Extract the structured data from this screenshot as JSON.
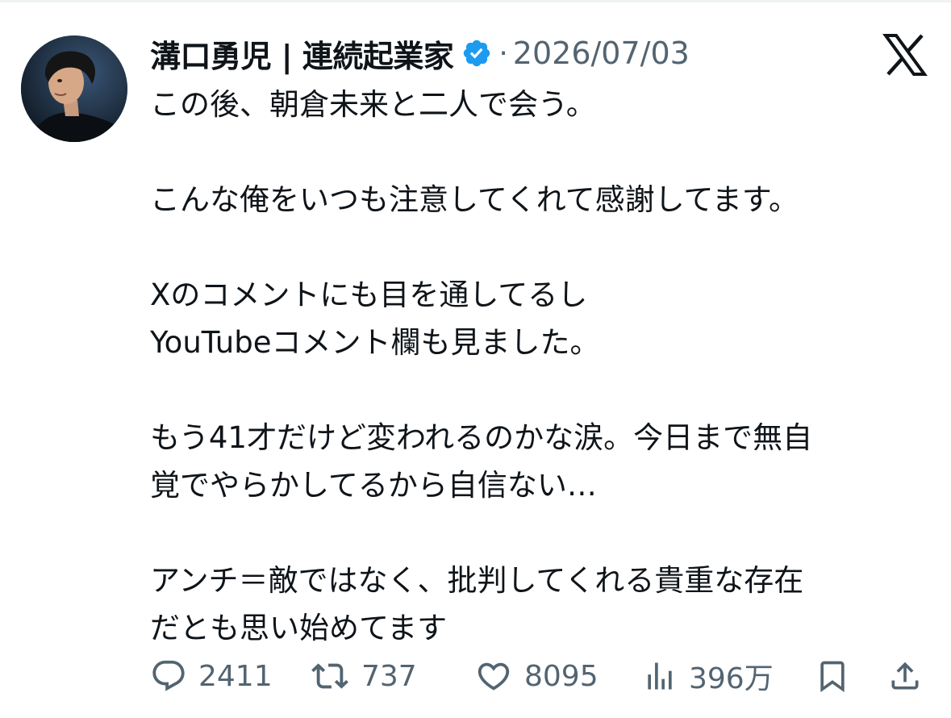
{
  "tweet": {
    "author_name": "溝口勇児 | 連続起業家",
    "separator": "·",
    "date": "2026/07/03",
    "verified_icon": "verified-badge-icon",
    "brand_icon": "x-logo-icon",
    "paragraphs": [
      [
        "この後、朝倉未来と二人で会う。"
      ],
      [
        "こんな俺をいつも注意してくれて感謝してます。"
      ],
      [
        "Xのコメントにも目を通してるし",
        "YouTubeコメント欄も見ました。"
      ],
      [
        "もう41才だけど変われるのかな涙。今日まで無自",
        "覚でやらかしてるから自信ない…"
      ],
      [
        "アンチ＝敵ではなく、批判してくれる貴重な存在",
        "だとも思い始めてます"
      ]
    ]
  },
  "actions": {
    "reply": {
      "count": "2411",
      "icon": "reply-icon"
    },
    "repost": {
      "count": "737",
      "icon": "repost-icon"
    },
    "like": {
      "count": "8095",
      "icon": "heart-icon"
    },
    "views": {
      "count": "396万",
      "icon": "views-chart-icon"
    },
    "bookmark": {
      "icon": "bookmark-icon"
    },
    "share": {
      "icon": "share-icon"
    }
  },
  "colors": {
    "text": "#0f1419",
    "secondary": "#536471",
    "verified": "#1d9bf0",
    "background": "#ffffff"
  }
}
